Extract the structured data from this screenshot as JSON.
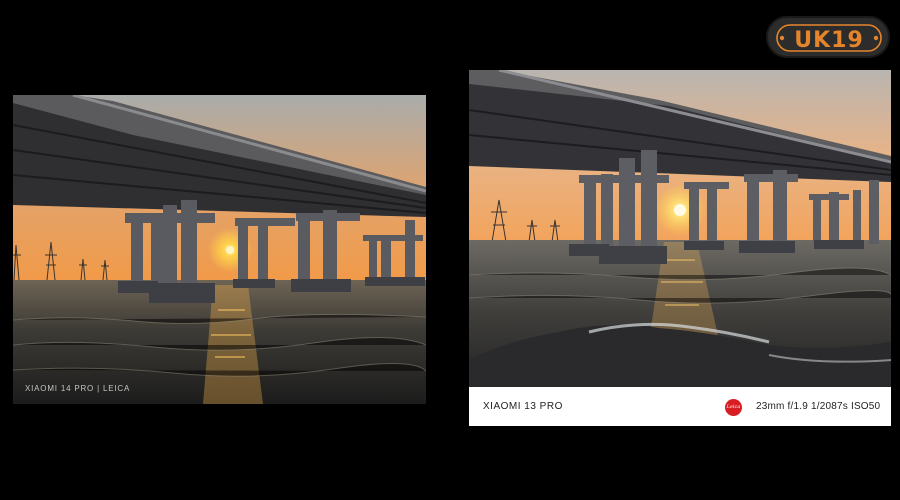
{
  "logo": {
    "text": "UK19",
    "colors": {
      "ring": "#e4852c",
      "text": "#e4852c",
      "background": "#2c2c2c"
    }
  },
  "photo_left": {
    "description_icon": "sunset-bridge-photo",
    "watermark": "XIAOMI 14 PRO | LEICA"
  },
  "photo_right": {
    "description_icon": "sunset-bridge-photo",
    "info_bar": {
      "model": "XIAOMI 13 PRO",
      "brand_badge": "Leica",
      "exif": "23mm  f/1.9  1/2087s  ISO50"
    }
  },
  "colors": {
    "leica_red": "#d81e23",
    "sun": "#ffd24a",
    "page_background": "#000000"
  }
}
